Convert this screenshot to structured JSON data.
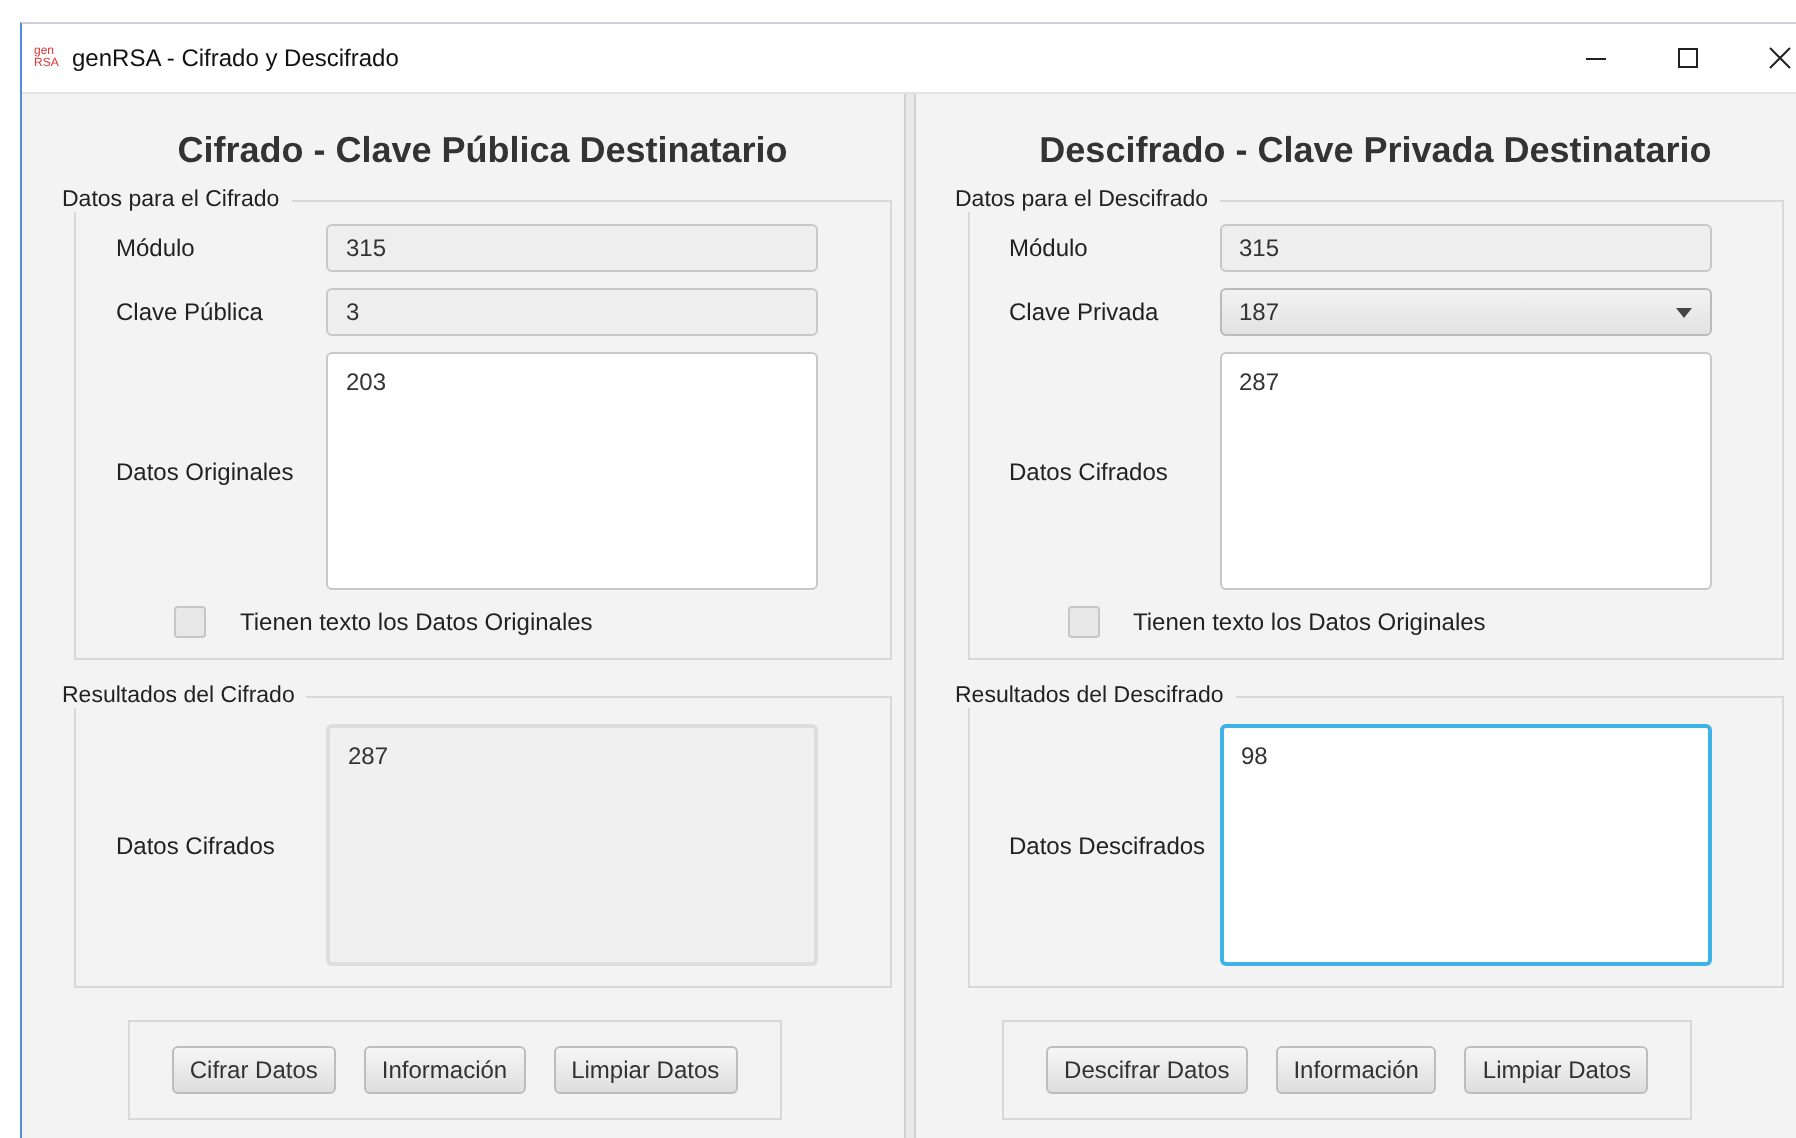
{
  "window": {
    "title": "genRSA - Cifrado y Descifrado",
    "logo_top": "gen",
    "logo_bottom": "RSA"
  },
  "panels": [
    {
      "heading": "Cifrado - Clave Pública Destinatario",
      "input_group": {
        "legend": "Datos para el Cifrado",
        "rows": [
          {
            "kind": "readonly",
            "label": "Módulo",
            "value": "315"
          },
          {
            "kind": "readonly",
            "label": "Clave Pública",
            "value": "3"
          },
          {
            "kind": "textarea",
            "label": "Datos Originales",
            "value": "203"
          }
        ],
        "checkbox": {
          "label": "Tienen texto los Datos Originales",
          "checked": false
        }
      },
      "result_group": {
        "legend": "Resultados del Cifrado",
        "label": "Datos Cifrados",
        "value": "287",
        "focused": false
      },
      "buttons": [
        "Cifrar Datos",
        "Información",
        "Limpiar Datos"
      ]
    },
    {
      "heading": "Descifrado - Clave Privada Destinatario",
      "input_group": {
        "legend": "Datos para el Descifrado",
        "rows": [
          {
            "kind": "readonly",
            "label": "Módulo",
            "value": "315"
          },
          {
            "kind": "combo",
            "label": "Clave Privada",
            "value": "187"
          },
          {
            "kind": "textarea",
            "label": "Datos Cifrados",
            "value": "287"
          }
        ],
        "checkbox": {
          "label": "Tienen texto los Datos Originales",
          "checked": false
        }
      },
      "result_group": {
        "legend": "Resultados del Descifrado",
        "label": "Datos Descifrados",
        "value": "98",
        "focused": true
      },
      "buttons": [
        "Descifrar Datos",
        "Información",
        "Limpiar Datos"
      ]
    }
  ]
}
